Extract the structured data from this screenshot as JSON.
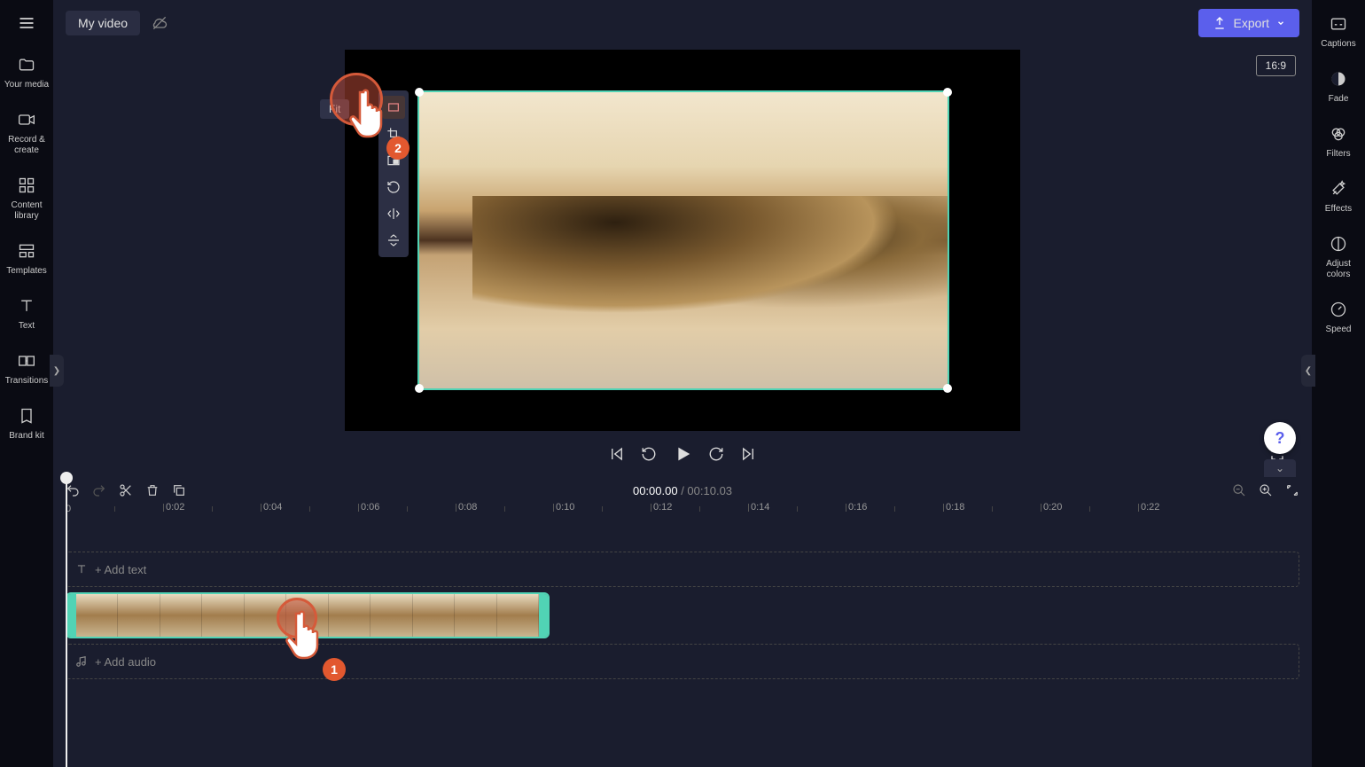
{
  "header": {
    "project_title": "My video",
    "export_label": "Export",
    "ratio_label": "16:9"
  },
  "left_nav": {
    "items": [
      {
        "label": "Your media",
        "icon": "media-icon"
      },
      {
        "label": "Record & create",
        "icon": "record-icon"
      },
      {
        "label": "Content library",
        "icon": "library-icon"
      },
      {
        "label": "Templates",
        "icon": "templates-icon"
      },
      {
        "label": "Text",
        "icon": "text-icon"
      },
      {
        "label": "Transitions",
        "icon": "transitions-icon"
      },
      {
        "label": "Brand kit",
        "icon": "brand-icon"
      }
    ]
  },
  "right_nav": {
    "items": [
      {
        "label": "Captions",
        "icon": "captions-icon"
      },
      {
        "label": "Fade",
        "icon": "fade-icon"
      },
      {
        "label": "Filters",
        "icon": "filters-icon"
      },
      {
        "label": "Effects",
        "icon": "effects-icon"
      },
      {
        "label": "Adjust colors",
        "icon": "adjust-icon"
      },
      {
        "label": "Speed",
        "icon": "speed-icon"
      }
    ]
  },
  "floating_toolbar": {
    "tooltip": "Fit",
    "items": [
      "fit",
      "crop",
      "picture-in-picture",
      "rotate",
      "flip-h",
      "flip-v"
    ]
  },
  "playback": {
    "current": "00:00.00",
    "duration": "00:10.03"
  },
  "ruler": {
    "start_label": "0",
    "labels": [
      "0:02",
      "0:04",
      "0:06",
      "0:08",
      "0:10",
      "0:12",
      "0:14",
      "0:16",
      "0:18",
      "0:20",
      "0:22"
    ],
    "spacing_px": 110
  },
  "tracks": {
    "add_text_label": "+ Add text",
    "add_audio_label": "+ Add audio"
  },
  "instructions": {
    "pointer1_badge": "1",
    "pointer2_badge": "2"
  },
  "help": "?"
}
